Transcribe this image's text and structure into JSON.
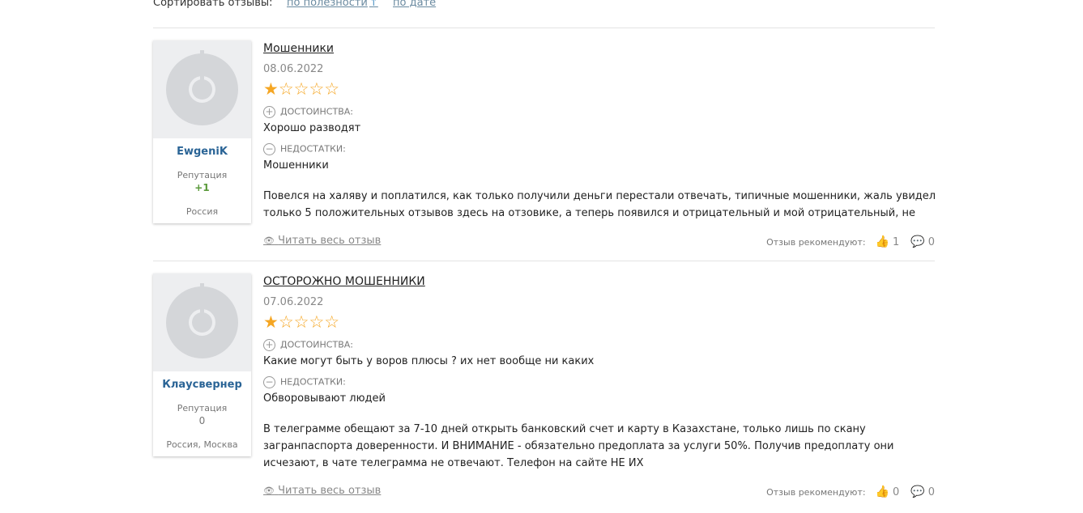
{
  "sort": {
    "label": "Сортировать отзывы:",
    "by_usefulness": "по полезности",
    "by_date": "по дате"
  },
  "reviews": [
    {
      "author": "EwgeniK",
      "reputation_label": "Репутация",
      "reputation": "+1",
      "location": "Россия",
      "title": "Мошенники",
      "date": "08.06.2022",
      "rating": 1,
      "stars_display": "★☆☆☆☆",
      "pros_label": "ДОСТОИНСТВА:",
      "pros": "Хорошо разводят",
      "cons_label": "НЕДОСТАТКИ:",
      "cons": "Мошенники",
      "text": "Повелся на халяву и поплатился, как только получили деньги перестали отвечать, типичные мошенники, жаль увидел только 5 положительных отзывов здесь на отзовике, а теперь появился и отрицательный и мой отрицательный, не",
      "read_more": "Читать весь отзыв",
      "recommend_label": "Отзыв рекомендуют:",
      "likes": "1",
      "comments": "0"
    },
    {
      "author": "Клаусвернер",
      "reputation_label": "Репутация",
      "reputation": "0",
      "location": "Россия, Москва",
      "title": "ОСТОРОЖНО МОШЕННИКИ",
      "date": "07.06.2022",
      "rating": 1,
      "stars_display": "★☆☆☆☆",
      "pros_label": "ДОСТОИНСТВА:",
      "pros": "Какие могут быть у воров плюсы ? их нет вообще ни каких",
      "cons_label": "НЕДОСТАТКИ:",
      "cons": "Обворовывают людей",
      "text": "В телеграмме обещают за 7-10 дней открыть банковский счет и карту в Казахстане, только лишь по скану загранпаспорта доверенности. И ВНИМАНИЕ - обязательно предоплата за услуги 50%. Получив предоплату они исчезают, в чате телеграмма не отвечают. Телефон на сайте НЕ ИХ",
      "read_more": "Читать весь отзыв",
      "recommend_label": "Отзыв рекомендуют:",
      "likes": "0",
      "comments": "0"
    }
  ],
  "icons": {
    "sort_arrow": "↑",
    "plus": "+",
    "minus": "−",
    "eye": "👁",
    "thumb": "👍",
    "comment": "💬"
  }
}
